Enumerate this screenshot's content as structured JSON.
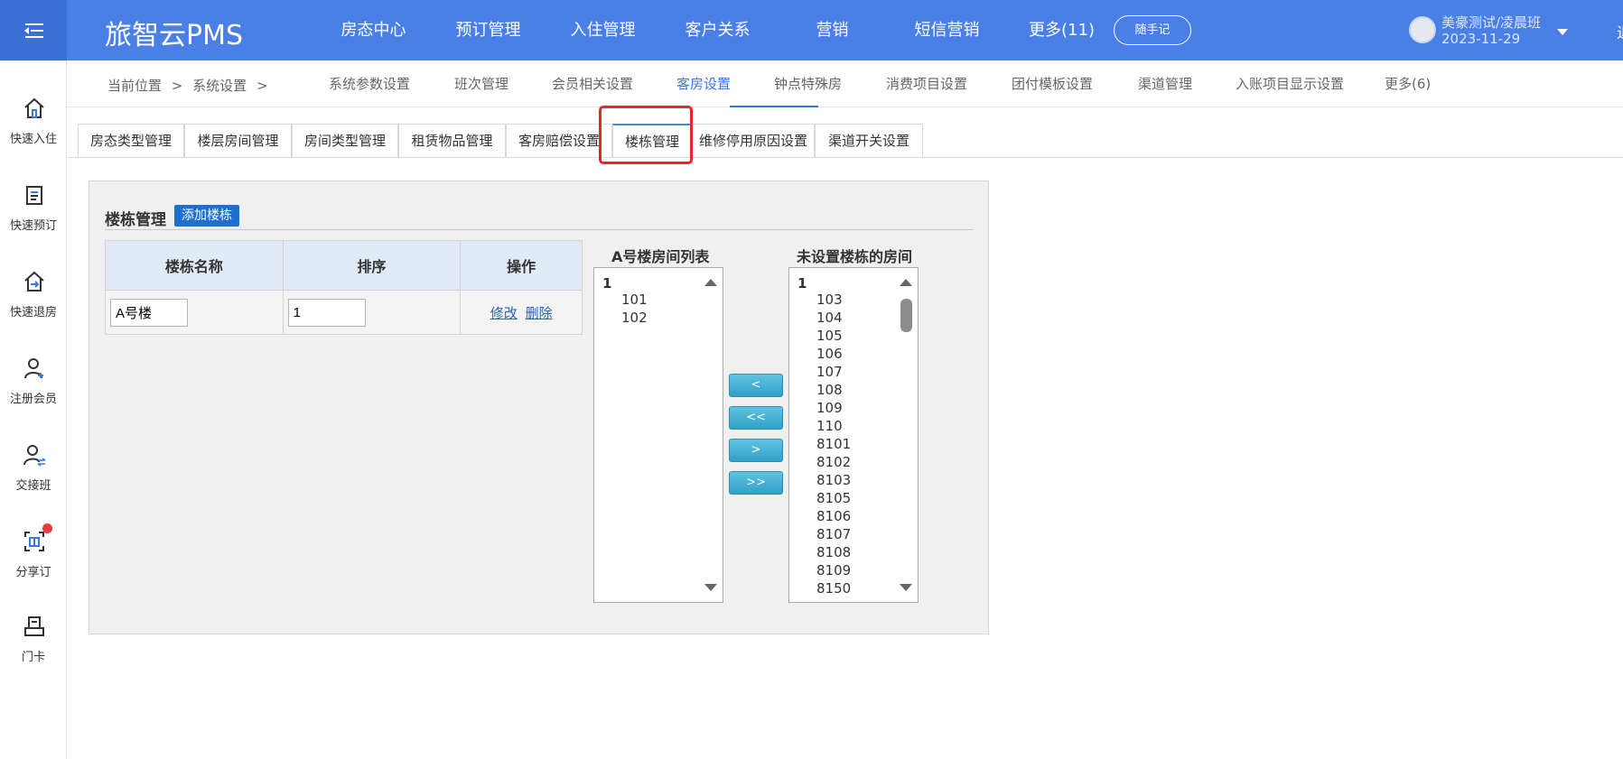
{
  "header": {
    "brand": "旅智云PMS",
    "nav": [
      "房态中心",
      "预订管理",
      "入住管理",
      "客户关系",
      "营销",
      "短信营销",
      "更多(11)"
    ],
    "note_button": "随手记",
    "user_name": "美豪测试/凌晨班",
    "user_date": "2023-11-29",
    "edge_text": "退"
  },
  "sidebar": [
    {
      "label": "快速入住",
      "icon": "home-icon"
    },
    {
      "label": "快速预订",
      "icon": "booking-icon"
    },
    {
      "label": "快速退房",
      "icon": "checkout-icon"
    },
    {
      "label": "注册会员",
      "icon": "add-member-icon"
    },
    {
      "label": "交接班",
      "icon": "handover-icon"
    },
    {
      "label": "分享订",
      "icon": "share-order-icon"
    },
    {
      "label": "门卡",
      "icon": "door-card-icon"
    }
  ],
  "breadcrumb": [
    "当前位置",
    ">",
    "系统设置",
    ">"
  ],
  "subnav": [
    "系统参数设置",
    "班次管理",
    "会员相关设置",
    "客房设置",
    "钟点特殊房",
    "消费项目设置",
    "团付模板设置",
    "渠道管理",
    "入账项目显示设置",
    "更多(6)"
  ],
  "subnav_active": "客房设置",
  "tabs": [
    "房态类型管理",
    "楼层房间管理",
    "房间类型管理",
    "租赁物品管理",
    "客房赔偿设置",
    "楼栋管理",
    "维修停用原因设置",
    "渠道开关设置"
  ],
  "tab_active": "楼栋管理",
  "panel": {
    "title": "楼栋管理",
    "add_button": "添加楼栋",
    "table": {
      "headers": [
        "楼栋名称",
        "排序",
        "操作"
      ],
      "rows": [
        {
          "name": "A号楼",
          "order": "1",
          "edit": "修改",
          "delete": "删除"
        }
      ]
    },
    "left_list": {
      "title": "A号楼房间列表",
      "group": "1",
      "options": [
        "101",
        "102"
      ]
    },
    "right_list": {
      "title": "未设置楼栋的房间",
      "group": "1",
      "options": [
        "103",
        "104",
        "105",
        "106",
        "107",
        "108",
        "109",
        "110",
        "8101",
        "8102",
        "8103",
        "8105",
        "8106",
        "8107",
        "8108",
        "8109",
        "8150"
      ]
    },
    "move_buttons": [
      "<",
      "<<",
      ">",
      ">>"
    ]
  },
  "colors": {
    "brand_blue": "#4a7fe6",
    "highlight_red": "#e8252b",
    "active_tab": "#3a78e0"
  }
}
